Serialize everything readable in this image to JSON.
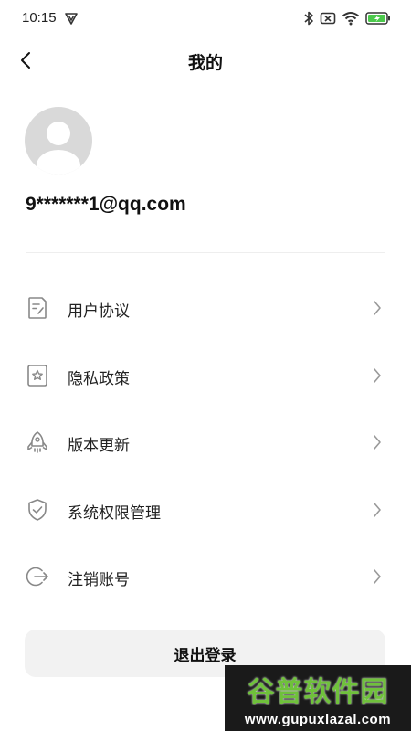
{
  "status_bar": {
    "time": "10:15",
    "icons": [
      "shield-v-icon",
      "bluetooth-icon",
      "no-sim-icon",
      "wifi-icon",
      "battery-charging-icon"
    ]
  },
  "header": {
    "title": "我的",
    "back_icon": "chevron-left-icon"
  },
  "profile": {
    "avatar_icon": "default-avatar-icon",
    "email": "9*******1@qq.com"
  },
  "menu": {
    "items": [
      {
        "label": "用户协议",
        "icon": "document-edit-icon"
      },
      {
        "label": "隐私政策",
        "icon": "star-document-icon"
      },
      {
        "label": "版本更新",
        "icon": "rocket-icon"
      },
      {
        "label": "系统权限管理",
        "icon": "shield-check-icon"
      },
      {
        "label": "注销账号",
        "icon": "logout-icon"
      }
    ],
    "chevron_icon": "chevron-right-icon"
  },
  "logout": {
    "label": "退出登录"
  },
  "watermark": {
    "title": "谷普软件园",
    "url": "www.gupuxlazal.com"
  },
  "colors": {
    "background": "#ffffff",
    "text": "#111111",
    "icon_gray": "#888888",
    "avatar_bg": "#d9d9d9",
    "button_bg": "#f2f2f2",
    "battery_green": "#4cc94c"
  }
}
